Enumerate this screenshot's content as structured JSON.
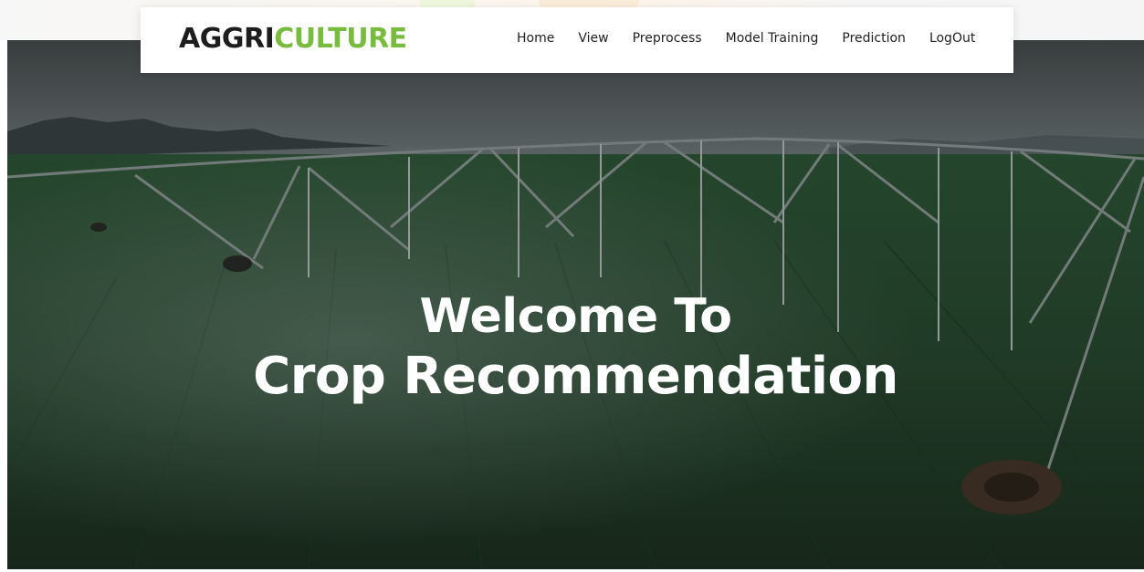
{
  "brand": {
    "part1": "AGGRI",
    "part2": "CULTURE",
    "accent_color": "#77bb3f"
  },
  "nav": {
    "items": [
      {
        "label": "Home"
      },
      {
        "label": "View"
      },
      {
        "label": "Preprocess"
      },
      {
        "label": "Model Training"
      },
      {
        "label": "Prediction"
      },
      {
        "label": "LogOut"
      }
    ]
  },
  "hero": {
    "line1": "Welcome To",
    "line2": "Crop Recommendation",
    "image": "irrigation-field-photo"
  }
}
